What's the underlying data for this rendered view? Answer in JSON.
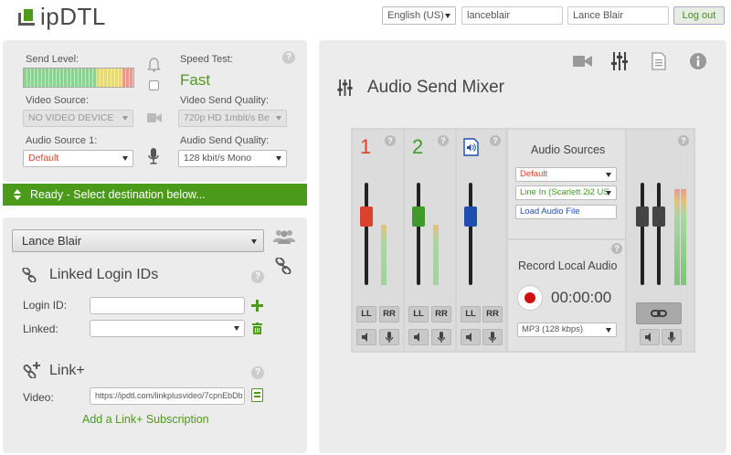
{
  "header": {
    "logo": "ipDTL",
    "language": "English (US)",
    "username": "lanceblair",
    "display_name": "Lance Blair",
    "logout": "Log out"
  },
  "left_top": {
    "send_level_label": "Send Level:",
    "speed_test_label": "Speed Test:",
    "speed_test_value": "Fast",
    "video_source_label": "Video Source:",
    "video_source_value": "NO VIDEO DEVICE",
    "video_quality_label": "Video Send Quality:",
    "video_quality_value": "720p HD 1mbit/s Be",
    "audio_source_label": "Audio Source 1:",
    "audio_source_value": "Default",
    "audio_quality_label": "Audio Send Quality:",
    "audio_quality_value": "128 kbit/s Mono"
  },
  "status": {
    "text": "Ready - Select destination below..."
  },
  "left_bottom": {
    "destination": "Lance Blair",
    "linked_title": "Linked Login IDs",
    "login_id_label": "Login ID:",
    "linked_label": "Linked:",
    "linkplus_title": "Link+",
    "video_label": "Video:",
    "video_url": "https://ipdtl.com/linkplusvideo/7cpnEbDb",
    "add_subscription": "Add a Link+ Subscription"
  },
  "mixer": {
    "title": "Audio Send Mixer",
    "channels": [
      {
        "num": "1",
        "ll": "LL",
        "rr": "RR",
        "color": "#d9432b"
      },
      {
        "num": "2",
        "ll": "LL",
        "rr": "RR",
        "color": "#3f9a2a"
      },
      {
        "num": "",
        "ll": "LL",
        "rr": "RR",
        "color": "#1e4fb0"
      }
    ],
    "sources_title": "Audio Sources",
    "source_1": "Default",
    "source_2": "Line In (Scarlett 2i2 US",
    "load_file": "Load Audio File",
    "record_title": "Record Local Audio",
    "timer": "00:00:00",
    "format": "MP3 (128 kbps)"
  },
  "colors": {
    "accent_green": "#4c9a1a",
    "ch1": "#d9432b",
    "ch2": "#3f9a2a",
    "ch3": "#1e4fb0"
  }
}
